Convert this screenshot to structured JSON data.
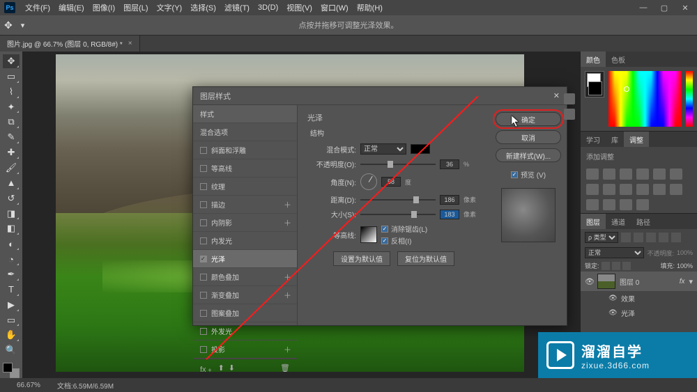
{
  "menu": {
    "items": [
      "文件(F)",
      "编辑(E)",
      "图像(I)",
      "图层(L)",
      "文字(Y)",
      "选择(S)",
      "滤镜(T)",
      "3D(D)",
      "视图(V)",
      "窗口(W)",
      "帮助(H)"
    ]
  },
  "option_hint": "点按并拖移可调整光泽效果。",
  "doc_tab": {
    "title": "图片.jpg @ 66.7% (图层 0, RGB/8#) *"
  },
  "status": {
    "zoom": "66.67%",
    "doc": "文档:6.59M/6.59M"
  },
  "panels": {
    "color_tab": "颜色",
    "swatch_tab": "色板",
    "learn_tab": "学习",
    "lib_tab": "库",
    "adjust_tab": "调整",
    "adjust_title": "添加调整",
    "layers_tab": "图层",
    "channels_tab": "通道",
    "paths_tab": "路径",
    "filter_label": "ρ 类型",
    "blend_mode": "正常",
    "opacity_label": "不透明度:",
    "opacity_value": "100%",
    "fill_label": "填充:",
    "fill_value": "100%",
    "lock_label": "锁定:",
    "layer0": "图层 0",
    "fx_label": "fx",
    "effects": "效果",
    "satin": "光泽"
  },
  "dialog": {
    "title": "图层样式",
    "styles": {
      "header": "样式",
      "blend": "混合选项",
      "bevel": "斜面和浮雕",
      "contour": "等高线",
      "texture": "纹理",
      "stroke": "描边",
      "inner_shadow": "内阴影",
      "inner_glow": "内发光",
      "satin": "光泽",
      "color_overlay": "颜色叠加",
      "grad_overlay": "渐变叠加",
      "pattern_overlay": "图案叠加",
      "outer_glow": "外发光",
      "drop_shadow": "投影"
    },
    "satin_section": "光泽",
    "structure": "结构",
    "blend_mode_label": "混合模式:",
    "blend_mode_value": "正常",
    "opacity_label": "不透明度(O):",
    "opacity_value": "36",
    "opacity_unit": "%",
    "angle_label": "角度(N):",
    "angle_value": "58",
    "angle_unit": "度",
    "distance_label": "距离(D):",
    "distance_value": "186",
    "distance_unit": "像素",
    "size_label": "大小(S):",
    "size_value": "183",
    "size_unit": "像素",
    "contour_label": "等高线:",
    "anti_alias": "消除锯齿(L)",
    "invert": "反相(I)",
    "set_default": "设置为默认值",
    "reset_default": "复位为默认值",
    "ok": "确定",
    "cancel": "取消",
    "new_style": "新建样式(W)...",
    "preview": "预览 (V)"
  },
  "watermark": {
    "brand": "溜溜自学",
    "url": "zixue.3d66.com"
  }
}
